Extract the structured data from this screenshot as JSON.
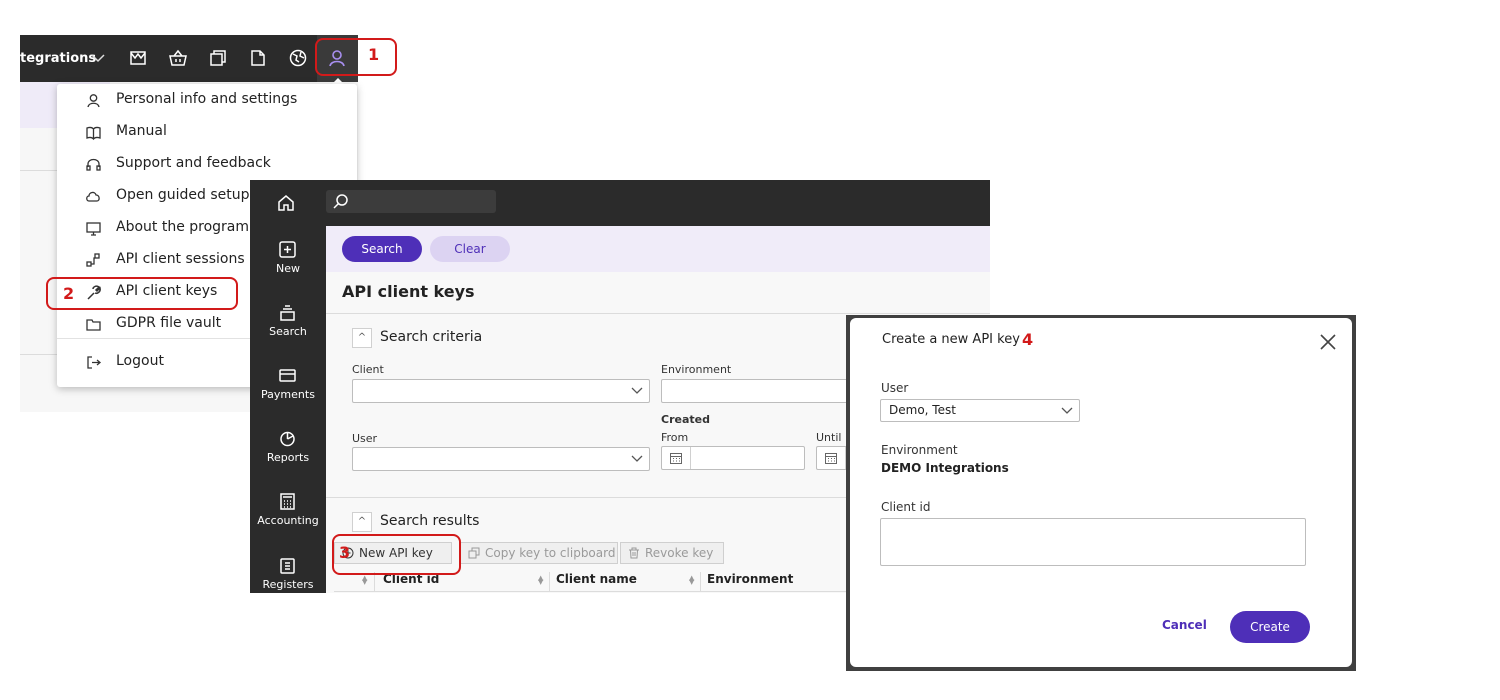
{
  "topbar": {
    "environment_label": "tegrations",
    "icons": [
      "chevron-down-icon",
      "inbox-icon",
      "basket-icon",
      "copy-icon",
      "document-icon",
      "globe-icon",
      "user-icon"
    ]
  },
  "user_menu": {
    "items": [
      {
        "label": "Personal info and settings",
        "icon": "user-icon"
      },
      {
        "label": "Manual",
        "icon": "book-icon"
      },
      {
        "label": "Support and feedback",
        "icon": "headset-icon"
      },
      {
        "label": "Open guided setup",
        "icon": "cloud-icon"
      },
      {
        "label": "About the program",
        "icon": "monitor-icon"
      },
      {
        "label": "API client sessions",
        "icon": "network-icon"
      },
      {
        "label": "API client keys",
        "icon": "wrench-icon"
      },
      {
        "label": "GDPR file vault",
        "icon": "folder-icon"
      },
      {
        "label": "Logout",
        "icon": "logout-icon"
      }
    ]
  },
  "sidebar": {
    "items": [
      {
        "label": "New",
        "icon": "plus-square-icon"
      },
      {
        "label": "Search",
        "icon": "stack-icon"
      },
      {
        "label": "Payments",
        "icon": "card-icon"
      },
      {
        "label": "Reports",
        "icon": "pie-chart-icon"
      },
      {
        "label": "Accounting",
        "icon": "calculator-icon"
      },
      {
        "label": "Registers",
        "icon": "clipboard-icon"
      }
    ]
  },
  "actionbar": {
    "search_label": "Search",
    "clear_label": "Clear"
  },
  "page": {
    "title": "API client keys",
    "search_criteria": {
      "title": "Search criteria",
      "client_label": "Client",
      "environment_label": "Environment",
      "created_label": "Created",
      "from_label": "From",
      "until_label": "Until",
      "user_label": "User"
    },
    "search_results": {
      "title": "Search results",
      "new_key_label": "New API key",
      "copy_key_label": "Copy key to clipboard",
      "revoke_key_label": "Revoke key",
      "columns": [
        "Client id",
        "Client name",
        "Environment"
      ]
    }
  },
  "modal": {
    "title": "Create a new API key",
    "user_label": "User",
    "user_value": "Demo, Test",
    "environment_label": "Environment",
    "environment_value": "DEMO Integrations",
    "client_id_label": "Client id",
    "client_id_value": "",
    "cancel_label": "Cancel",
    "create_label": "Create"
  },
  "annotations": {
    "step1": "1",
    "step2": "2",
    "step3": "3",
    "step4": "4"
  },
  "colors": {
    "accent": "#4e2fb8",
    "topbar": "#2b2b2b",
    "annotation": "#d21a1a",
    "lavender": "#f0ecf9"
  }
}
